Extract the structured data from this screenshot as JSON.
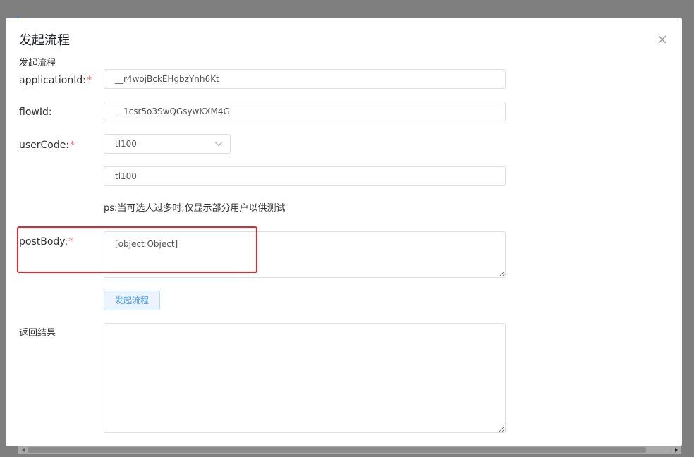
{
  "dialog": {
    "title": "发起流程",
    "subtitle": "发起流程"
  },
  "form": {
    "applicationId": {
      "label": "applicationId:",
      "required_mark": "*",
      "value": "__r4wojBckEHgbzYnh6Kt"
    },
    "flowId": {
      "label": "flowId:",
      "value": "__1csr5o3SwQGsywKXM4G"
    },
    "userCode": {
      "label": "userCode:",
      "required_mark": "*",
      "selected": "tl100",
      "input_value": "tl100",
      "hint": "ps:当可选人过多时,仅显示部分用户以供测试"
    },
    "postBody": {
      "label": "postBody:",
      "required_mark": "*",
      "value": "[object Object]"
    },
    "submit_label": "发起流程",
    "result": {
      "label": "返回结果",
      "value": ""
    }
  },
  "icons": {
    "close": "close-icon",
    "dropdown": "chevron-down-icon"
  },
  "colors": {
    "overlay": "#7f7f7f",
    "required": "#f56c6c",
    "primary": "#409eff",
    "highlight": "#e5262b"
  }
}
